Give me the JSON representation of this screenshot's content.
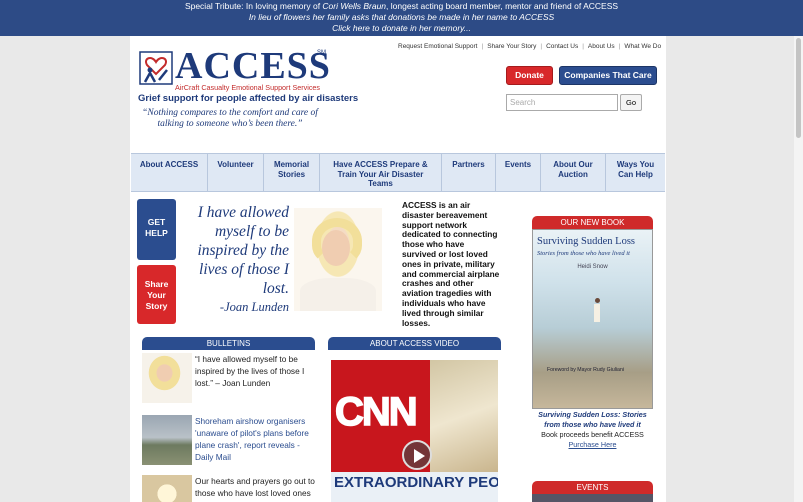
{
  "tribute": {
    "line1_prefix": "Special Tribute: In loving memory of ",
    "line1_name": "Cori Wells Braun",
    "line1_suffix": ", longest acting board member, mentor and friend of ACCESS",
    "line2": "In lieu of flowers her family asks that donations be made in her name to ACCESS",
    "line3": "Click here to donate in her memory..."
  },
  "logo": {
    "word": "ACCESS",
    "tm": "SM",
    "subtitle": "AirCraft Casualty Emotional Support Services"
  },
  "tagline": "Grief support for people affected by air disasters",
  "quote": "“Nothing compares to the comfort and care of talking to someone who’s been there.”",
  "top_links": [
    "Request Emotional Support",
    "Share Your Story",
    "Contact Us",
    "About Us",
    "What We Do"
  ],
  "buttons": {
    "donate": "Donate",
    "companies": "Companies That Care",
    "go": "Go"
  },
  "search": {
    "placeholder": "Search"
  },
  "nav": [
    {
      "label": "About ACCESS"
    },
    {
      "label": "Volunteer"
    },
    {
      "label": "Memorial Stories"
    },
    {
      "label": "Have ACCESS Prepare & Train Your Air Disaster Teams"
    },
    {
      "label": "Partners"
    },
    {
      "label": "Events"
    },
    {
      "label": "About Our Auction"
    },
    {
      "label": "Ways You Can Help"
    }
  ],
  "side_buttons": {
    "get_help": "GET HELP",
    "share_story": "Share Your Story"
  },
  "big_quote": {
    "text": "I have allowed myself to be inspired by the lives of those I lost.",
    "by": "-Joan Lunden"
  },
  "about_text": "ACCESS is an air disaster bereavement support network dedicated to connecting those who have survived or lost loved ones in private, military and commercial airplane crashes and other aviation tragedies with individuals who have lived through similar losses.",
  "sections": {
    "bulletins": "BULLETINS",
    "video": "ABOUT ACCESS VIDEO",
    "book": "OUR NEW BOOK",
    "events": "EVENTS"
  },
  "bulletins": [
    {
      "text": "“I have allowed myself to be inspired by the lives of those I lost.” – Joan Lunden"
    },
    {
      "link": "Shoreham airshow organisers 'unaware of pilot's plans before plane crash', report reveals - Daily Mail"
    },
    {
      "text": "Our hearts and prayers go out to those who have lost loved ones"
    }
  ],
  "video": {
    "logo": "CNN",
    "banner": "EXTRAORDINARY PEOPLE"
  },
  "book": {
    "title": "Surviving Sudden Loss",
    "subtitle": "Stories from those who have lived it",
    "author": "Heidi Snow",
    "foreword": "Foreword by Mayor Rudy Giuliani",
    "caption_title": "Surviving Sudden Loss: Stories from those who have lived it",
    "caption_note": "Book proceeds benefit ACCESS",
    "caption_link": "Purchase Here"
  },
  "colors": {
    "brand_blue": "#2b4d8f",
    "brand_red": "#d8282a",
    "tribute_bar": "#2d4b86"
  }
}
